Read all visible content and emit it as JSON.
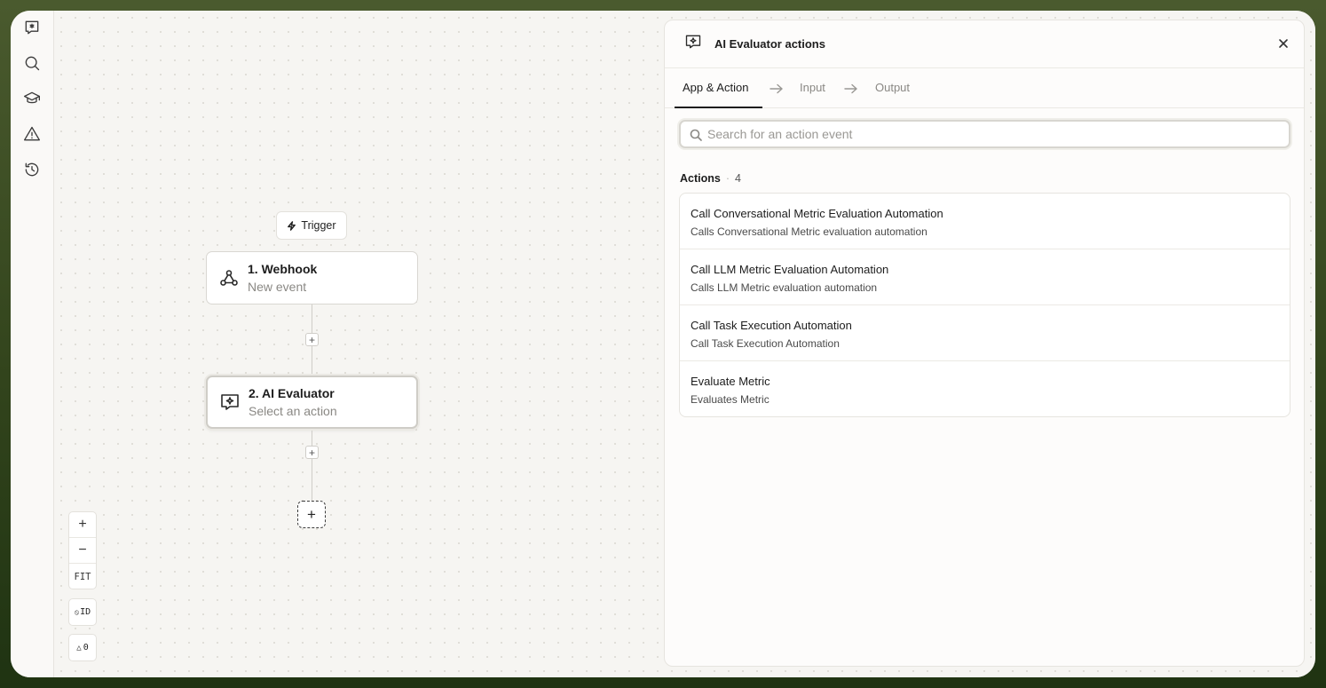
{
  "sidebar": {
    "items": [
      {
        "icon": "logo-chat-icon"
      },
      {
        "icon": "search-icon"
      },
      {
        "icon": "graduation-cap-icon"
      },
      {
        "icon": "warning-icon"
      },
      {
        "icon": "history-icon"
      }
    ]
  },
  "canvas": {
    "trigger_label": "Trigger",
    "nodes": [
      {
        "title": "1. Webhook",
        "subtitle": "New event",
        "icon": "webhook-icon"
      },
      {
        "title": "2. AI Evaluator",
        "subtitle": "Select an action",
        "icon": "ai-evaluator-icon"
      }
    ],
    "add_step_symbol": "+",
    "controls": {
      "zoom_in": "+",
      "zoom_out": "−",
      "fit": "FIT",
      "id_toggle": "ID",
      "warnings_count": "0"
    }
  },
  "panel": {
    "title": "AI Evaluator actions",
    "tabs": [
      "App & Action",
      "Input",
      "Output"
    ],
    "active_tab": "App & Action",
    "search": {
      "placeholder": "Search for an action event",
      "value": ""
    },
    "actions_label": "Actions",
    "actions_count": "4",
    "actions": [
      {
        "title": "Call Conversational Metric Evaluation Automation",
        "description": "Calls Conversational Metric evaluation automation"
      },
      {
        "title": "Call LLM Metric Evaluation Automation",
        "description": "Calls LLM Metric evaluation automation"
      },
      {
        "title": "Call Task Execution Automation",
        "description": "Call Task Execution Automation"
      },
      {
        "title": "Evaluate Metric",
        "description": "Evaluates Metric"
      }
    ]
  },
  "colors": {
    "background": "#3d4e24",
    "canvas": "#f6f5f2",
    "text_primary": "#1d1d1d",
    "text_muted": "#8a8884"
  }
}
